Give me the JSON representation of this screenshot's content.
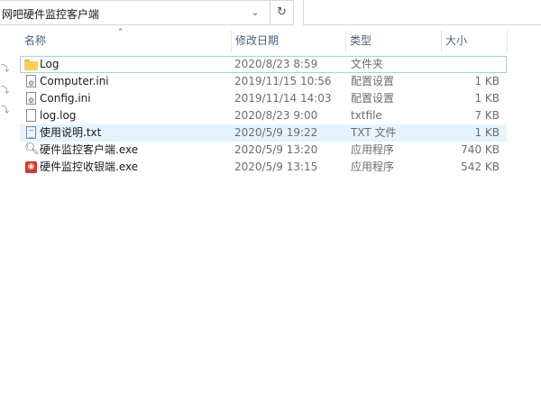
{
  "address": {
    "path": "网吧硬件监控客户端",
    "dropdown_icon": "chevron-down-icon",
    "refresh_icon": "refresh-icon"
  },
  "columns": {
    "name": "名称",
    "date": "修改日期",
    "type": "类型",
    "size": "大小"
  },
  "files": [
    {
      "name": "Log",
      "date": "2020/8/23 8:59",
      "type": "文件夹",
      "size": "",
      "icon": "folder-icon"
    },
    {
      "name": "Computer.ini",
      "date": "2019/11/15 10:56",
      "type": "配置设置",
      "size": "1 KB",
      "icon": "config-file-icon"
    },
    {
      "name": "Config.ini",
      "date": "2019/11/14 14:03",
      "type": "配置设置",
      "size": "1 KB",
      "icon": "config-file-icon"
    },
    {
      "name": "log.log",
      "date": "2020/8/23 9:00",
      "type": "txtfile",
      "size": "7 KB",
      "icon": "file-icon"
    },
    {
      "name": "使用说明.txt",
      "date": "2020/5/9 19:22",
      "type": "TXT 文件",
      "size": "1 KB",
      "icon": "text-file-icon"
    },
    {
      "name": "硬件监控客户端.exe",
      "date": "2020/5/9 13:20",
      "type": "应用程序",
      "size": "740 KB",
      "icon": "search-app-icon"
    },
    {
      "name": "硬件监控收银端.exe",
      "date": "2020/5/9 13:15",
      "type": "应用程序",
      "size": "542 KB",
      "icon": "red-app-icon"
    }
  ]
}
